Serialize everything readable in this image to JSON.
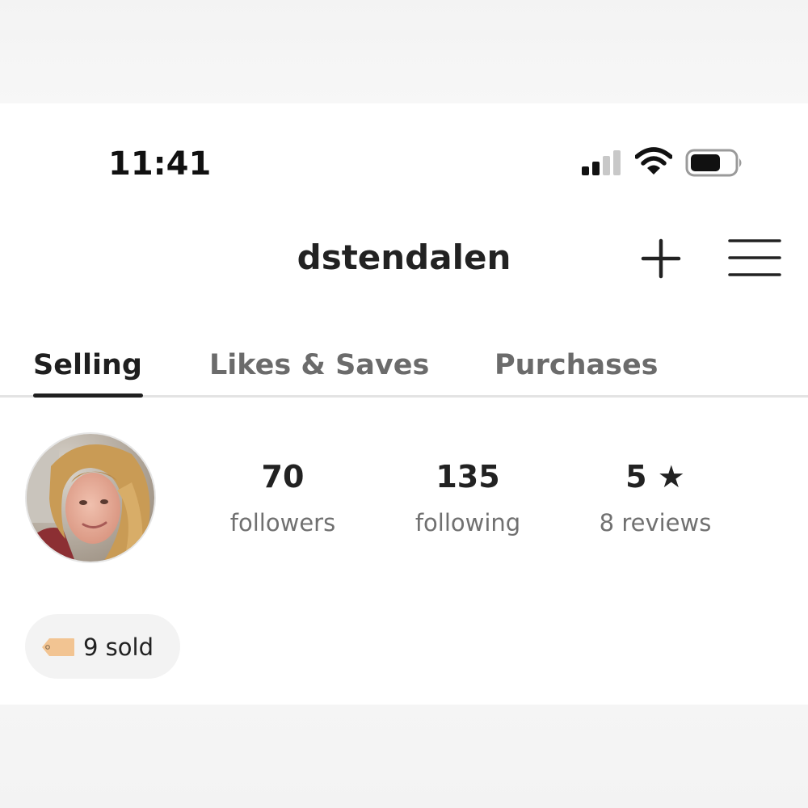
{
  "status_bar": {
    "time": "11:41",
    "signal_icon": "cellular-signal-icon",
    "wifi_icon": "wifi-icon",
    "battery_icon": "battery-icon"
  },
  "header": {
    "username": "dstendalen",
    "add_icon": "plus-icon",
    "menu_icon": "hamburger-menu-icon"
  },
  "tabs": [
    {
      "label": "Selling",
      "active": true
    },
    {
      "label": "Likes & Saves",
      "active": false
    },
    {
      "label": "Purchases",
      "active": false
    }
  ],
  "profile": {
    "stats": [
      {
        "value": "70",
        "label": "followers"
      },
      {
        "value": "135",
        "label": "following"
      },
      {
        "value": "5 ★",
        "label": "8 reviews"
      }
    ],
    "sold_badge": {
      "icon": "price-tag-icon",
      "text": "9 sold"
    }
  },
  "colors": {
    "text_primary": "#1f1f1f",
    "text_secondary": "#707070",
    "tab_inactive": "#6b6b6b",
    "tag_icon": "#f2c492",
    "chip_bg": "#f3f3f3"
  }
}
